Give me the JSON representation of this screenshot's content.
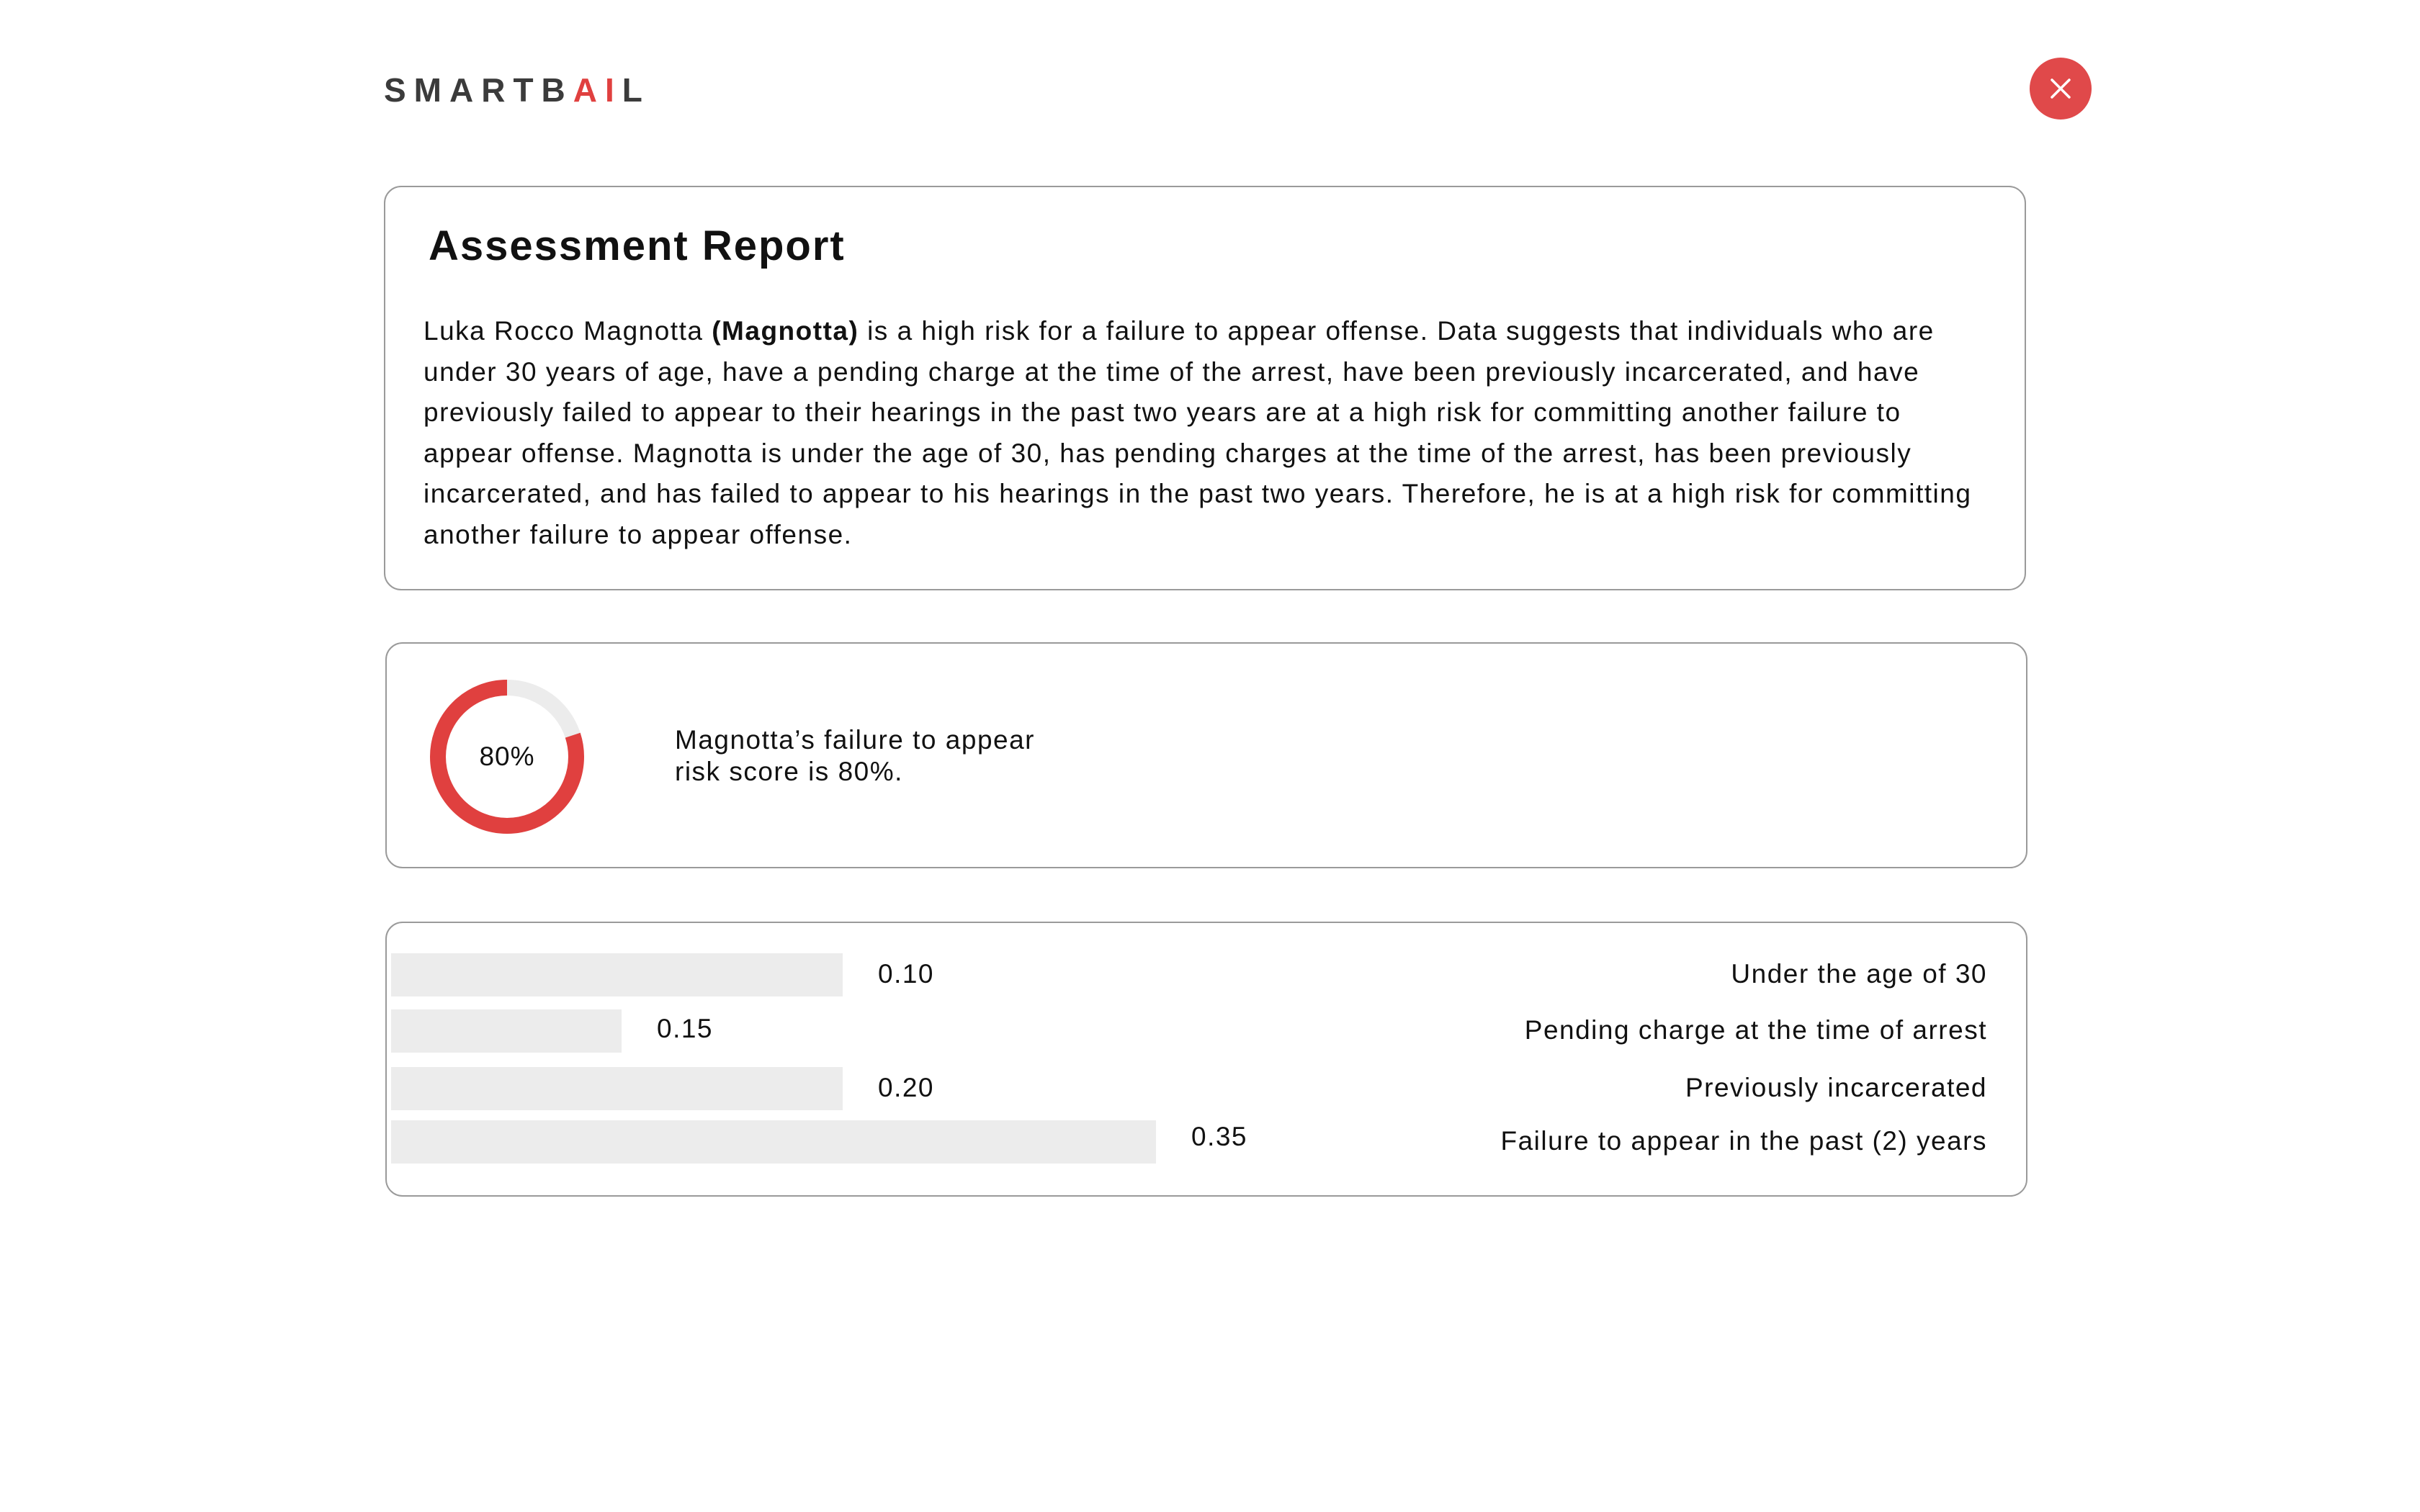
{
  "header": {
    "logo_main": "SMARTB",
    "logo_accent": "AI",
    "logo_tail": "L",
    "accent_color": "#e0403f",
    "close_icon": "close-icon"
  },
  "report": {
    "title": "Assessment Report",
    "subject_name": "Luka Rocco Magnotta",
    "subject_short": "(Magnotta)",
    "body_text": "is a high risk for a failure to appear offense. Data suggests that individuals who are under 30 years of age, have a pending charge at the time of the arrest, have been previously incarcerated, and have previously failed to appear to their hearings in the past two years are at a high risk for committing another failure to appear offense. Magnotta is under the age of 30, has pending charges at the time of the arrest, has been previously incarcerated, and has failed to appear to his hearings in the past two years. Therefore, he is at a high risk for committing another failure to appear offense."
  },
  "score": {
    "value": 0.8,
    "label": "80%",
    "description_line1": "Magnotta’s failure to appear",
    "description_line2": "risk score is 80%.",
    "ring_color": "#e0403f",
    "track_color": "#ececec"
  },
  "factors": [
    {
      "label": "Under the age of 30",
      "value_text": "0.10"
    },
    {
      "label": "Pending charge at the time of arrest",
      "value_text": "0.15"
    },
    {
      "label": "Previously incarcerated",
      "value_text": "0.20"
    },
    {
      "label": "Failure to appear in the past (2) years",
      "value_text": "0.35"
    }
  ]
}
